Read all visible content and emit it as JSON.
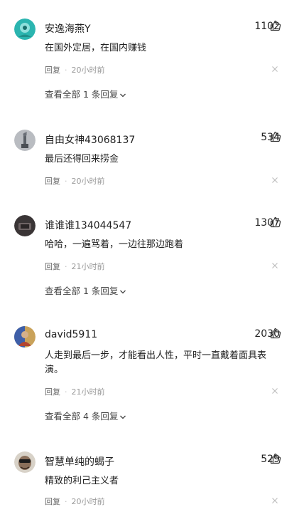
{
  "comments": [
    {
      "username": "安逸海燕Y",
      "likes": "1102",
      "text": "在国外定居，在国内赚钱",
      "reply_label": "回复",
      "time": "20小时前",
      "more_replies": "查看全部 1 条回复"
    },
    {
      "username": "自由女神43068137",
      "likes": "534",
      "text": "最后还得回来捞金",
      "reply_label": "回复",
      "time": "20小时前",
      "more_replies": ""
    },
    {
      "username": "谁谁谁134044547",
      "likes": "1307",
      "text": "哈哈，一遍骂着，一边往那边跑着",
      "reply_label": "回复",
      "time": "21小时前",
      "more_replies": "查看全部 1 条回复"
    },
    {
      "username": "david5911",
      "likes": "2030",
      "text": "人走到最后一步，才能看出人性，平时一直戴着面具表演。",
      "reply_label": "回复",
      "time": "21小时前",
      "more_replies": "查看全部 4 条回复"
    },
    {
      "username": "智慧单纯的蝎子",
      "likes": "529",
      "text": "精致的利己主义者",
      "reply_label": "回复",
      "time": "20小时前",
      "more_replies": ""
    }
  ],
  "icons": {
    "like": "thumbs-up-icon",
    "close": "close-icon",
    "expand": "chevron-down-icon"
  }
}
